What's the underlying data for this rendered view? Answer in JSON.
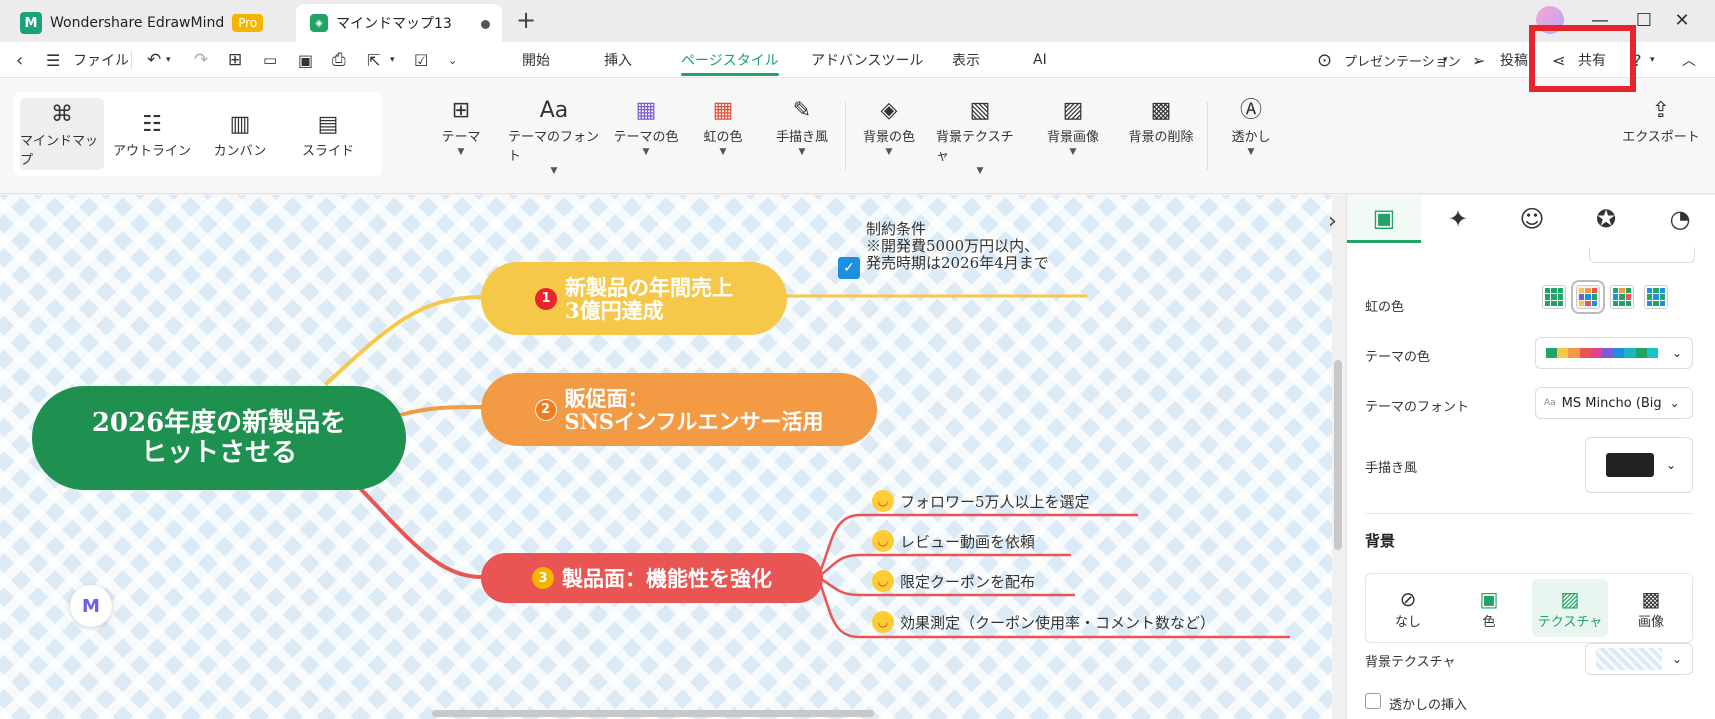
{
  "titlebar": {
    "app_name": "Wondershare EdrawMind",
    "pro_badge": "Pro",
    "doc_tab": "マインドマップ13",
    "new_tab": "+",
    "minimize": "—",
    "maximize": "☐",
    "close": "✕"
  },
  "menubar": {
    "file": "ファイル",
    "tabs": [
      "開始",
      "挿入",
      "ページスタイル",
      "アドバンスツール",
      "表示",
      "AI"
    ],
    "presentation": "プレゼンテーション",
    "post": "投稿",
    "share": "共有"
  },
  "toolbar": {
    "views": [
      "マインドマップ",
      "アウトライン",
      "カンバン",
      "スライド"
    ],
    "tools": [
      "テーマ",
      "テーマのフォント",
      "テーマの色",
      "虹の色",
      "手描き風",
      "背景の色",
      "背景テクスチャ",
      "背景画像",
      "背景の削除",
      "透かし"
    ],
    "export": "エクスポート"
  },
  "mindmap": {
    "root": "2026年度の新製品を\nヒットさせる",
    "branches": [
      {
        "num": "1",
        "label": "新製品の年間売上\n3億円達成",
        "color": "#f5c84a"
      },
      {
        "num": "2",
        "label": "販促面：\nSNSインフルエンサー活用",
        "color": "#f39a45"
      },
      {
        "num": "3",
        "label": "製品面：機能性を強化",
        "color": "#e85552"
      }
    ],
    "note": "制約条件\n※開発費5000万円以内、\n発売時期は2026年4月まで",
    "subitems": [
      "フォロワー5万人以上を選定",
      "レビュー動画を依頼",
      "限定クーポンを配布",
      "効果測定（クーポン使用率・コメント数など）"
    ]
  },
  "panel": {
    "rainbow_label": "虹の色",
    "theme_color_label": "テーマの色",
    "theme_font_label": "テーマのフォント",
    "theme_font_value": "MS Mincho (Big",
    "handdrawn_label": "手描き風",
    "background_header": "背景",
    "bg_options": [
      "なし",
      "色",
      "テクスチャ",
      "画像"
    ],
    "bg_texture_label": "背景テクスチャ",
    "watermark_label": "透かしの挿入"
  },
  "colors": {
    "accent": "#21a366",
    "root": "#1e9150",
    "highlight": "#e8252f"
  }
}
